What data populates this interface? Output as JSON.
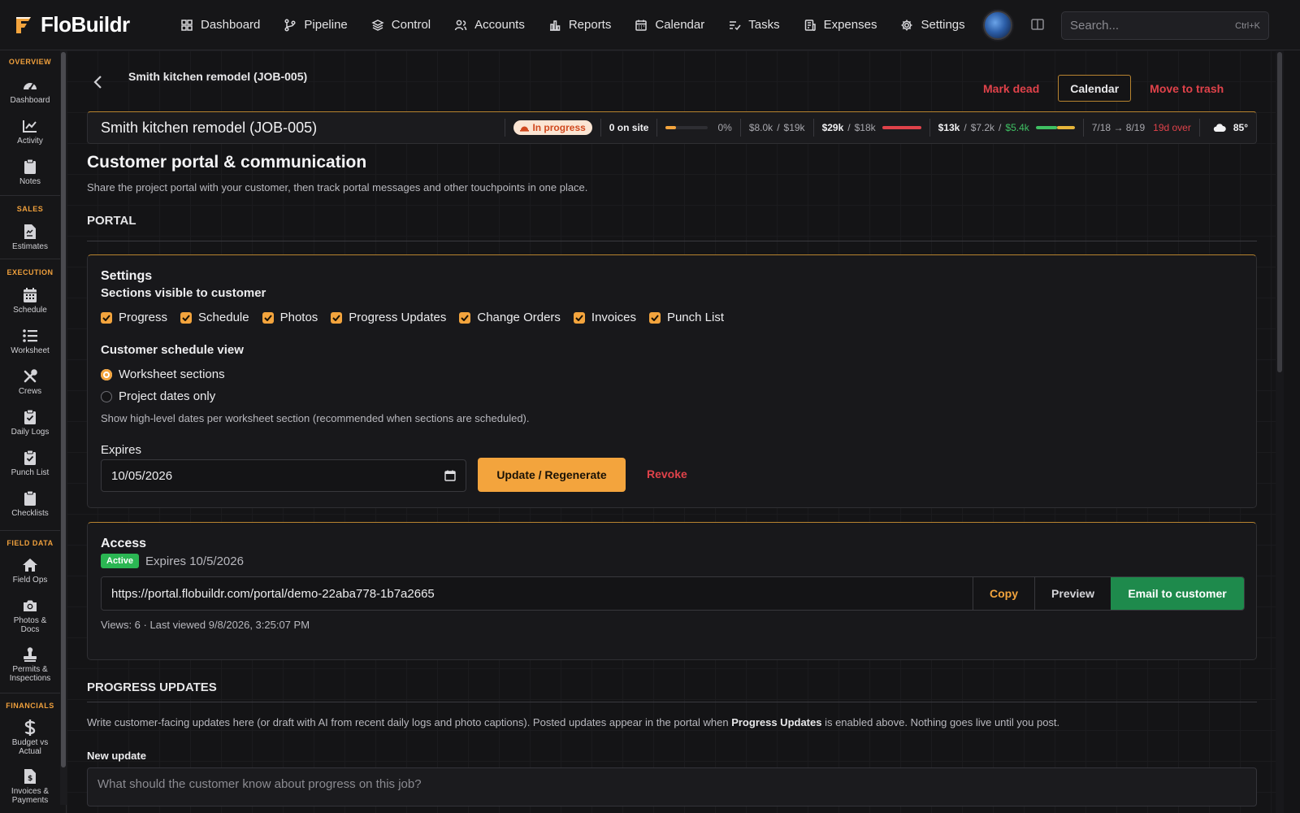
{
  "app": {
    "name": "FloBuildr",
    "brand_color": "#f3a43d"
  },
  "nav": {
    "items": [
      {
        "label": "Dashboard",
        "icon": "grid-icon"
      },
      {
        "label": "Pipeline",
        "icon": "branch-icon"
      },
      {
        "label": "Control",
        "icon": "layers-icon"
      },
      {
        "label": "Accounts",
        "icon": "users-icon"
      },
      {
        "label": "Reports",
        "icon": "bar-chart-icon"
      },
      {
        "label": "Calendar",
        "icon": "calendar-icon"
      },
      {
        "label": "Tasks",
        "icon": "tasks-icon"
      },
      {
        "label": "Expenses",
        "icon": "receipt-icon"
      },
      {
        "label": "Settings",
        "icon": "gear-icon"
      }
    ],
    "search_placeholder": "Search...",
    "search_shortcut": "Ctrl+K"
  },
  "sidebar": {
    "sections": [
      {
        "label": "OVERVIEW"
      },
      {
        "label": "SALES"
      },
      {
        "label": "EXECUTION"
      },
      {
        "label": "FIELD DATA"
      },
      {
        "label": "FINANCIALS"
      }
    ],
    "items": [
      {
        "label": "Dashboard",
        "icon": "gauge-icon"
      },
      {
        "label": "Activity",
        "icon": "activity-chart-icon"
      },
      {
        "label": "Notes",
        "icon": "clipboard-icon"
      },
      {
        "label": "Estimates",
        "icon": "document-icon"
      },
      {
        "label": "Schedule",
        "icon": "calendar-grid-icon"
      },
      {
        "label": "Worksheet",
        "icon": "list-icon"
      },
      {
        "label": "Crews",
        "icon": "tools-icon"
      },
      {
        "label": "Daily Logs",
        "icon": "clipboard-check-icon"
      },
      {
        "label": "Punch List",
        "icon": "clipboard-check-icon"
      },
      {
        "label": "Checklists",
        "icon": "clipboard-icon"
      },
      {
        "label": "Field Ops",
        "icon": "home-icon"
      },
      {
        "label": "Photos &",
        "label2": "Docs",
        "icon": "camera-icon"
      },
      {
        "label": "Permits &",
        "label2": "Inspections",
        "icon": "stamp-icon"
      },
      {
        "label": "Budget vs",
        "label2": "Actual",
        "icon": "dollar-icon"
      },
      {
        "label": "Invoices &",
        "label2": "Payments",
        "icon": "invoice-icon"
      }
    ]
  },
  "header": {
    "breadcrumb": "Smith kitchen remodel (JOB-005)",
    "mark_dead": "Mark dead",
    "calendar": "Calendar",
    "move_to_trash": "Move to trash"
  },
  "status_bar": {
    "title": "Smith kitchen remodel (JOB-005)",
    "status": "In progress",
    "on_site": "0 on site",
    "progress_pct": "0%",
    "progress_fraction": 0.25,
    "budget_a": "$8.0k",
    "budget_b": "$19k",
    "cost_a": "$29k",
    "cost_b": "$18k",
    "cost_fill_color": "#e0424a",
    "rev_a": "$13k",
    "rev_b": "$7.2k",
    "rev_c": "$5.4k",
    "dates": "7/18 → 8/19",
    "over": "19d over",
    "weather": "85°",
    "sep": "/"
  },
  "page": {
    "title": "Customer portal & communication",
    "subtitle": "Share the project portal with your customer, then track portal messages and other touchpoints in one place.",
    "portal_heading": "PORTAL"
  },
  "settings_card": {
    "title": "Settings",
    "sections_label": "Sections visible to customer",
    "checkboxes": [
      "Progress",
      "Schedule",
      "Photos",
      "Progress Updates",
      "Change Orders",
      "Invoices",
      "Punch List"
    ],
    "schedule_view_label": "Customer schedule view",
    "radio_worksheet": "Worksheet sections",
    "radio_project": "Project dates only",
    "selected_radio": "Worksheet sections",
    "help": "Show high-level dates per worksheet section (recommended when sections are scheduled).",
    "expires_label": "Expires",
    "expires_value": "10/05/2026",
    "update_button": "Update / Regenerate",
    "revoke_button": "Revoke"
  },
  "access_card": {
    "title": "Access",
    "badge": "Active",
    "expires_text": "Expires 10/5/2026",
    "url": "https://portal.flobuildr.com/portal/demo-22aba778-1b7a2665",
    "copy": "Copy",
    "preview": "Preview",
    "email": "Email to customer",
    "views": "Views: 6 · Last viewed 9/8/2026, 3:25:07 PM"
  },
  "progress_updates": {
    "heading": "PROGRESS UPDATES",
    "desc_pre": "Write customer-facing updates here (or draft with AI from recent daily logs and photo captions). Posted updates appear in the portal when ",
    "desc_bold": "Progress Updates",
    "desc_post": " is enabled above. Nothing goes live until you post.",
    "new_update_label": "New update",
    "placeholder": "What should the customer know about progress on this job?"
  }
}
